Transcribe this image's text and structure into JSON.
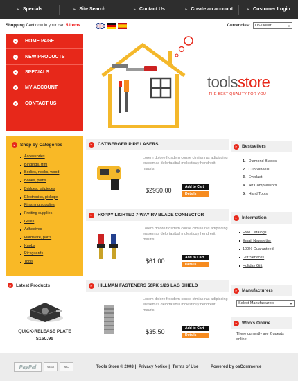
{
  "topnav": [
    {
      "label": "Specials"
    },
    {
      "label": "Site Search"
    },
    {
      "label": "Contact Us"
    },
    {
      "label": "Create an account"
    },
    {
      "label": "Customer Login"
    }
  ],
  "cart": {
    "label": "Shopping Cart",
    "text": "now in your cart",
    "count": "5 items"
  },
  "currencies": {
    "label": "Currencies:",
    "value": "US Dollar"
  },
  "leftnav": [
    {
      "label": "HOME PAGE"
    },
    {
      "label": "NEW PRODUCTS"
    },
    {
      "label": "SPECIALS"
    },
    {
      "label": "MY ACCOUNT"
    },
    {
      "label": "CONTACT US"
    }
  ],
  "brand": {
    "part1": "tools",
    "part2": "store",
    "tagline": "THE BEST QUALITY FOR YOU"
  },
  "categories": {
    "title": "Shop by Categories",
    "items": [
      "Accessories",
      "Bindings, trim",
      "Bodies, necks, wood",
      "Books, plans",
      "Bridges, tailpieces",
      "Electronics, pickups",
      "Finishing supplies",
      "Fretting supplies",
      "Glues",
      "Adhesives",
      "Hardware, parts",
      "Knobs",
      "Pickguards",
      "Tools"
    ]
  },
  "latest": {
    "title": "Latest Products",
    "name": "QUICK-RELEASE PLATE",
    "price": "$150.95"
  },
  "products": [
    {
      "title": "CST/BERGER PIPE LASERS",
      "desc": "Lorem dolore frosdem conse ctmias ras adipiscing erasemas delortasibul molesticuy hendrerit mauris.",
      "price": "$2950.00",
      "add": "Add to Cart",
      "details": "Details"
    },
    {
      "title": "HOPPY LIGHTED 7-WAY RV BLADE CONNECTOR",
      "desc": "Lorem dolore frosdem conse ctmias ras adipiscing erasemas delortasibul molesticuy hendrerit mauris.",
      "price": "$61.00",
      "add": "Add to Cart",
      "details": "Details"
    },
    {
      "title": "HILLMAN FASTENERS 50PK 1/2S LAG SHIELD",
      "desc": "Lorem dolore frosdem conse ctmias ras adipiscing erasemas delortasibul molesticuy hendrerit mauris.",
      "price": "$35.50",
      "add": "Add to Cart",
      "details": "Details"
    }
  ],
  "bestsellers": {
    "title": "Bestsellers",
    "items": [
      {
        "num": "1.",
        "name": "Diamond Blades"
      },
      {
        "num": "2.",
        "name": "Cup Wheels"
      },
      {
        "num": "3.",
        "name": "Everlast"
      },
      {
        "num": "4.",
        "name": "Air Compressors"
      },
      {
        "num": "5.",
        "name": "Hand Tools"
      }
    ]
  },
  "information": {
    "title": "Information",
    "items": [
      "Free Catalogs",
      "Email Newsletter",
      "100% Guaranteed",
      "Gift Services",
      "Holiday Gift"
    ]
  },
  "manufacturers": {
    "title": "Manufacturers",
    "select": "Select Manufacturers"
  },
  "whosonline": {
    "title": "Who's Online",
    "text": "There currently are 2 guests online."
  },
  "footer": {
    "paypal": "PayPal",
    "visa": "VISA",
    "mc": "MC",
    "copyright": "Tools Store © 2008",
    "privacy": "Privacy Notice",
    "terms": "Terms of Use",
    "powered": "Powered by osCommerce"
  },
  "colors": {
    "accent": "#e7281a",
    "yellow": "#f9b926",
    "orange": "#f68b1f",
    "dark": "#2e2e2e"
  }
}
